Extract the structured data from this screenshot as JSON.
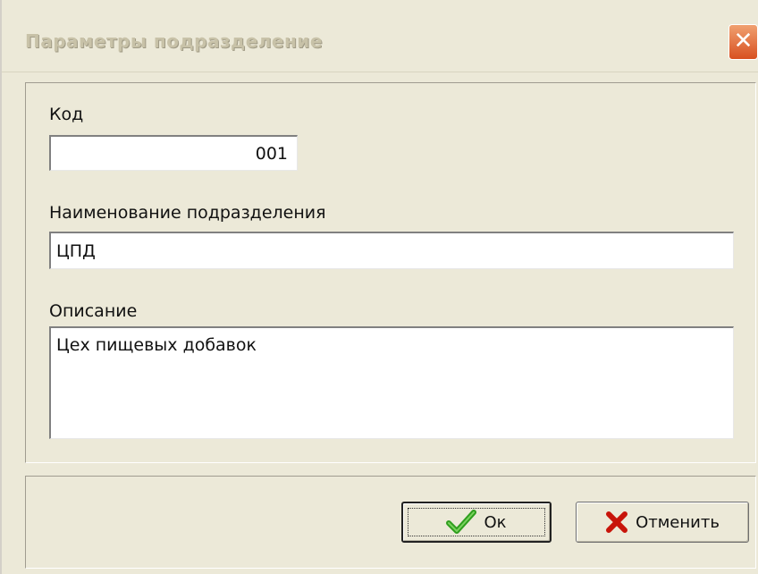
{
  "window": {
    "title": "Параметры подразделение"
  },
  "form": {
    "code": {
      "label": "Код",
      "value": "001"
    },
    "name": {
      "label": "Наименование подразделения",
      "value": "ЦПД"
    },
    "description": {
      "label": "Описание",
      "value": "Цех пищевых добавок"
    }
  },
  "buttons": {
    "ok": {
      "label": "Ок",
      "icon": "checkmark-icon"
    },
    "cancel": {
      "label": "Отменить",
      "icon": "cross-icon"
    }
  },
  "colors": {
    "window_bg": "#ece9d8",
    "close_button": "#d85020",
    "check_green": "#2f9e1e",
    "cross_red": "#c8140a"
  }
}
